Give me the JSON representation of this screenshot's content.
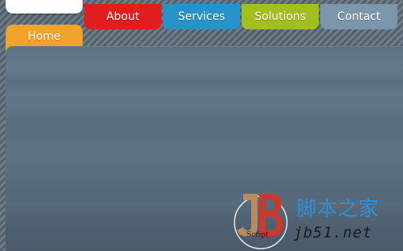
{
  "nav": {
    "home": "Home",
    "about": "About",
    "services": "Services",
    "solutions": "Solutions",
    "contact": "Contact"
  },
  "watermark": {
    "chinese": "脚本之家",
    "url": "jb51.net",
    "script_label": "Script"
  },
  "colors": {
    "home": "#f0a32a",
    "about": "#e21d1d",
    "services": "#2794c9",
    "solutions": "#a2bf1d",
    "contact": "#7c96ab"
  }
}
